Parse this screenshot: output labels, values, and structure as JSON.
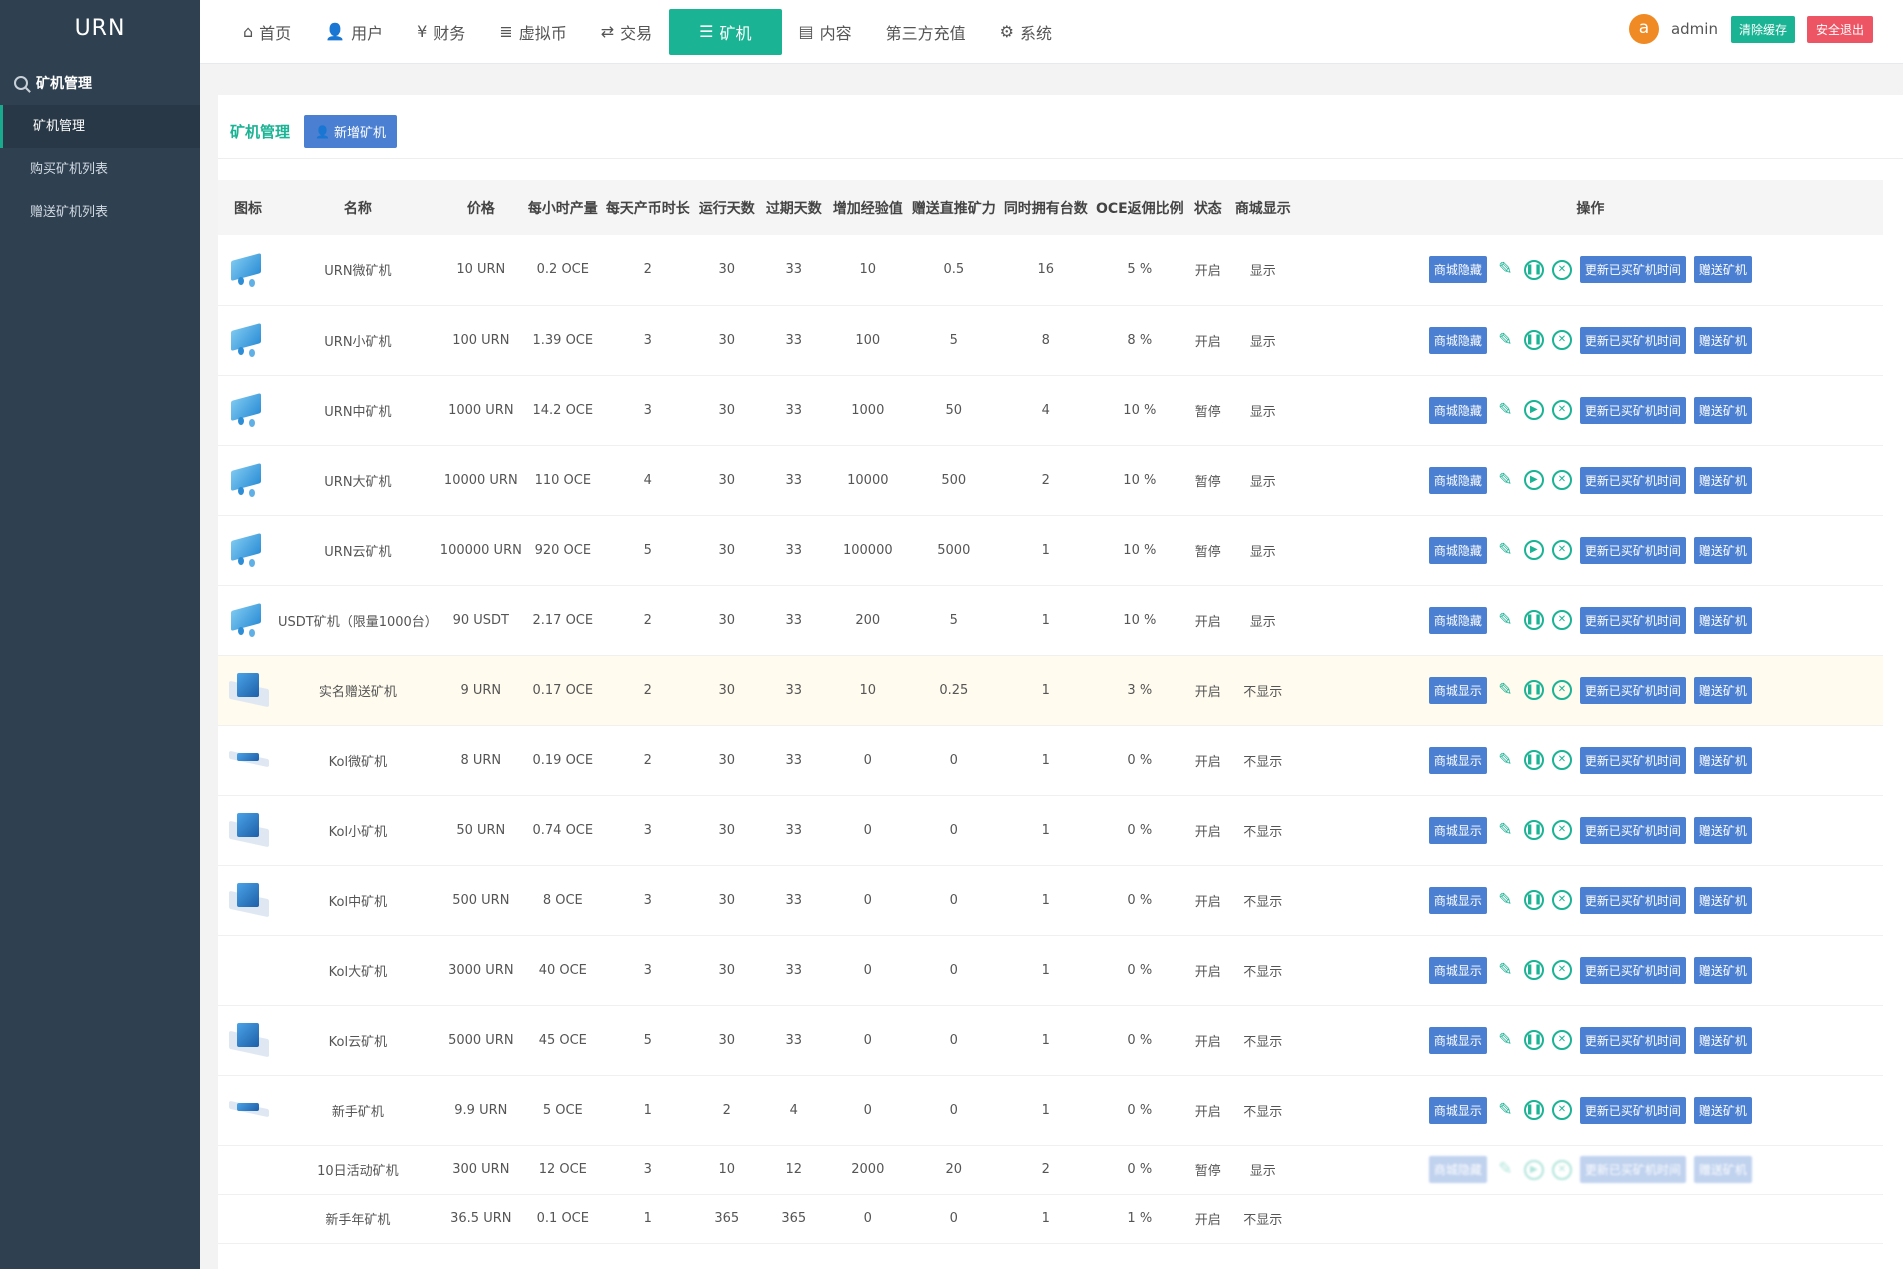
{
  "sidebar": {
    "brand": "URN",
    "section": "矿机管理",
    "items": [
      {
        "label": "矿机管理",
        "active": true
      },
      {
        "label": "购买矿机列表",
        "active": false
      },
      {
        "label": "赠送矿机列表",
        "active": false
      }
    ]
  },
  "nav": {
    "items": [
      {
        "label": "首页",
        "icon": "home-icon",
        "glyph": "⌂"
      },
      {
        "label": "用户",
        "icon": "user-icon",
        "glyph": "👤"
      },
      {
        "label": "财务",
        "icon": "yen-icon",
        "glyph": "¥"
      },
      {
        "label": "虚拟币",
        "icon": "database-icon",
        "glyph": "≣"
      },
      {
        "label": "交易",
        "icon": "exchange-icon",
        "glyph": "⇄"
      },
      {
        "label": "矿机",
        "icon": "server-icon",
        "glyph": "☰",
        "active": true
      },
      {
        "label": "内容",
        "icon": "list-icon",
        "glyph": "▤"
      },
      {
        "label": "第三方充值",
        "icon": "",
        "glyph": ""
      },
      {
        "label": "系统",
        "icon": "gear-icon",
        "glyph": "⚙"
      }
    ]
  },
  "user": {
    "avatar_letter": "a",
    "name": "admin",
    "clear_cache": "清除缓存",
    "logout": "安全退出"
  },
  "page": {
    "title": "矿机管理",
    "add_button": "新增矿机"
  },
  "table": {
    "headers": [
      "图标",
      "名称",
      "价格",
      "每小时产量",
      "每天产币时长",
      "运行天数",
      "过期天数",
      "增加经验值",
      "赠送直推矿力",
      "同时拥有台数",
      "OCE返佣比例",
      "状态",
      "商城显示",
      "操作"
    ],
    "rows": [
      {
        "img": "a",
        "name": "URN微矿机",
        "price": "10 URN",
        "hourly": "0.2 OCE",
        "daily_hours": "2",
        "run_days": "30",
        "expire_days": "33",
        "exp": "10",
        "power": "0.5",
        "max_own": "16",
        "rebate": "5 %",
        "status": "开启",
        "shop": "显示",
        "shop_btn": "商城隐藏",
        "toggle": "pause"
      },
      {
        "img": "a",
        "name": "URN小矿机",
        "price": "100 URN",
        "hourly": "1.39 OCE",
        "daily_hours": "3",
        "run_days": "30",
        "expire_days": "33",
        "exp": "100",
        "power": "5",
        "max_own": "8",
        "rebate": "8 %",
        "status": "开启",
        "shop": "显示",
        "shop_btn": "商城隐藏",
        "toggle": "pause"
      },
      {
        "img": "a",
        "name": "URN中矿机",
        "price": "1000 URN",
        "hourly": "14.2 OCE",
        "daily_hours": "3",
        "run_days": "30",
        "expire_days": "33",
        "exp": "1000",
        "power": "50",
        "max_own": "4",
        "rebate": "10 %",
        "status": "暂停",
        "shop": "显示",
        "shop_btn": "商城隐藏",
        "toggle": "play"
      },
      {
        "img": "a",
        "name": "URN大矿机",
        "price": "10000 URN",
        "hourly": "110 OCE",
        "daily_hours": "4",
        "run_days": "30",
        "expire_days": "33",
        "exp": "10000",
        "power": "500",
        "max_own": "2",
        "rebate": "10 %",
        "status": "暂停",
        "shop": "显示",
        "shop_btn": "商城隐藏",
        "toggle": "play"
      },
      {
        "img": "a",
        "name": "URN云矿机",
        "price": "100000 URN",
        "hourly": "920 OCE",
        "daily_hours": "5",
        "run_days": "30",
        "expire_days": "33",
        "exp": "100000",
        "power": "5000",
        "max_own": "1",
        "rebate": "10 %",
        "status": "暂停",
        "shop": "显示",
        "shop_btn": "商城隐藏",
        "toggle": "play"
      },
      {
        "img": "a",
        "name": "USDT矿机（限量1000台）",
        "price": "90 USDT",
        "hourly": "2.17 OCE",
        "daily_hours": "2",
        "run_days": "30",
        "expire_days": "33",
        "exp": "200",
        "power": "5",
        "max_own": "1",
        "rebate": "10 %",
        "status": "开启",
        "shop": "显示",
        "shop_btn": "商城隐藏",
        "toggle": "pause"
      },
      {
        "img": "b",
        "name": "实名赠送矿机",
        "price": "9 URN",
        "hourly": "0.17 OCE",
        "daily_hours": "2",
        "run_days": "30",
        "expire_days": "33",
        "exp": "10",
        "power": "0.25",
        "max_own": "1",
        "rebate": "3 %",
        "status": "开启",
        "shop": "不显示",
        "shop_btn": "商城显示",
        "toggle": "pause",
        "highlight": true
      },
      {
        "img": "bs",
        "name": "Kol微矿机",
        "price": "8 URN",
        "hourly": "0.19 OCE",
        "daily_hours": "2",
        "run_days": "30",
        "expire_days": "33",
        "exp": "0",
        "power": "0",
        "max_own": "1",
        "rebate": "0 %",
        "status": "开启",
        "shop": "不显示",
        "shop_btn": "商城显示",
        "toggle": "pause"
      },
      {
        "img": "b",
        "name": "Kol小矿机",
        "price": "50 URN",
        "hourly": "0.74 OCE",
        "daily_hours": "3",
        "run_days": "30",
        "expire_days": "33",
        "exp": "0",
        "power": "0",
        "max_own": "1",
        "rebate": "0 %",
        "status": "开启",
        "shop": "不显示",
        "shop_btn": "商城显示",
        "toggle": "pause"
      },
      {
        "img": "b",
        "name": "Kol中矿机",
        "price": "500 URN",
        "hourly": "8 OCE",
        "daily_hours": "3",
        "run_days": "30",
        "expire_days": "33",
        "exp": "0",
        "power": "0",
        "max_own": "1",
        "rebate": "0 %",
        "status": "开启",
        "shop": "不显示",
        "shop_btn": "商城显示",
        "toggle": "pause"
      },
      {
        "img": "",
        "name": "Kol大矿机",
        "price": "3000 URN",
        "hourly": "40 OCE",
        "daily_hours": "3",
        "run_days": "30",
        "expire_days": "33",
        "exp": "0",
        "power": "0",
        "max_own": "1",
        "rebate": "0 %",
        "status": "开启",
        "shop": "不显示",
        "shop_btn": "商城显示",
        "toggle": "pause"
      },
      {
        "img": "b",
        "name": "Kol云矿机",
        "price": "5000 URN",
        "hourly": "45 OCE",
        "daily_hours": "5",
        "run_days": "30",
        "expire_days": "33",
        "exp": "0",
        "power": "0",
        "max_own": "1",
        "rebate": "0 %",
        "status": "开启",
        "shop": "不显示",
        "shop_btn": "商城显示",
        "toggle": "pause"
      },
      {
        "img": "bs",
        "name": "新手矿机",
        "price": "9.9 URN",
        "hourly": "5 OCE",
        "daily_hours": "1",
        "run_days": "2",
        "expire_days": "4",
        "exp": "0",
        "power": "0",
        "max_own": "1",
        "rebate": "0 %",
        "status": "开启",
        "shop": "不显示",
        "shop_btn": "商城显示",
        "toggle": "pause"
      },
      {
        "img": "",
        "name": "10日活动矿机",
        "price": "300 URN",
        "hourly": "12 OCE",
        "daily_hours": "3",
        "run_days": "10",
        "expire_days": "12",
        "exp": "2000",
        "power": "20",
        "max_own": "2",
        "rebate": "0 %",
        "status": "暂停",
        "shop": "显示",
        "shop_btn": "商城隐藏",
        "toggle": "play",
        "faded_ops": true,
        "short": true
      },
      {
        "img": "",
        "name": "新手年矿机",
        "price": "36.5 URN",
        "hourly": "0.1 OCE",
        "daily_hours": "1",
        "run_days": "365",
        "expire_days": "365",
        "exp": "0",
        "power": "0",
        "max_own": "1",
        "rebate": "1 %",
        "status": "开启",
        "shop": "不显示",
        "no_ops": true,
        "short": true
      }
    ],
    "ops": {
      "edit_glyph": "✎",
      "pause_glyph": "❚❚",
      "play_glyph": "▶",
      "delete_glyph": "✕",
      "update_time": "更新已买矿机时间",
      "gift": "赠送矿机"
    }
  },
  "colors": {
    "sidebar": "#2f4050",
    "accent": "#1ab394",
    "primary": "#4b7fd1",
    "danger": "#ed5565"
  }
}
